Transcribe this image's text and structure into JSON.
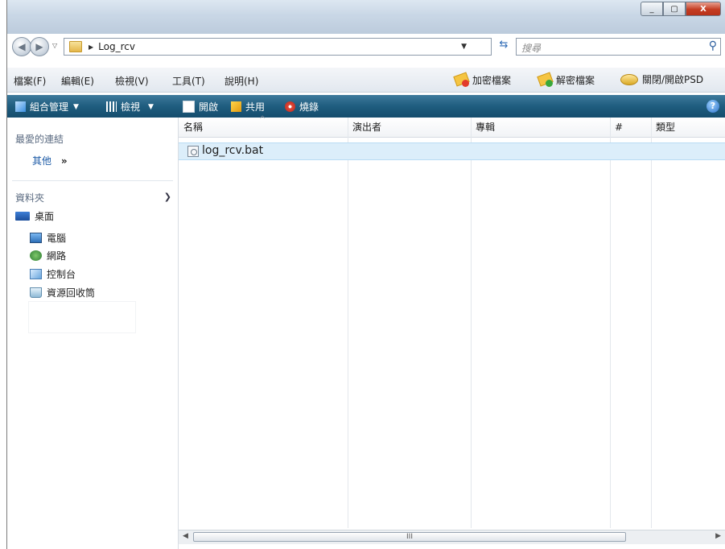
{
  "window": {
    "controls": {
      "minimize": "_",
      "maximize": "▢",
      "close": "X"
    }
  },
  "nav": {
    "address_path": "Log_rcv",
    "search_placeholder": "搜尋"
  },
  "menu": {
    "items": [
      "檔案(F)",
      "編輯(E)",
      "檢視(V)",
      "工具(T)",
      "說明(H)"
    ],
    "actions": [
      "加密檔案",
      "解密檔案",
      "關閉/開啟PSD"
    ]
  },
  "commandbar": {
    "items": [
      "組合管理",
      "檢視",
      "開啟",
      "共用",
      "燒錄"
    ],
    "help": "?"
  },
  "navpane": {
    "favorites_heading": "最愛的連結",
    "more_label": "其他",
    "more_chevron": "»",
    "folders_heading": "資料夾",
    "tree": [
      "桌面",
      "電腦",
      "網路",
      "控制台",
      "資源回收筒"
    ]
  },
  "filelist": {
    "columns": [
      "名稱",
      "演出者",
      "專輯",
      "#",
      "類型"
    ],
    "files": [
      {
        "name": "log_rcv.bat"
      }
    ]
  },
  "scrollbar": {
    "grip": "III"
  },
  "colors": {
    "command_bar": "#1f5d7f",
    "selected_row": "#dceefa",
    "close_button": "#c43c22"
  }
}
